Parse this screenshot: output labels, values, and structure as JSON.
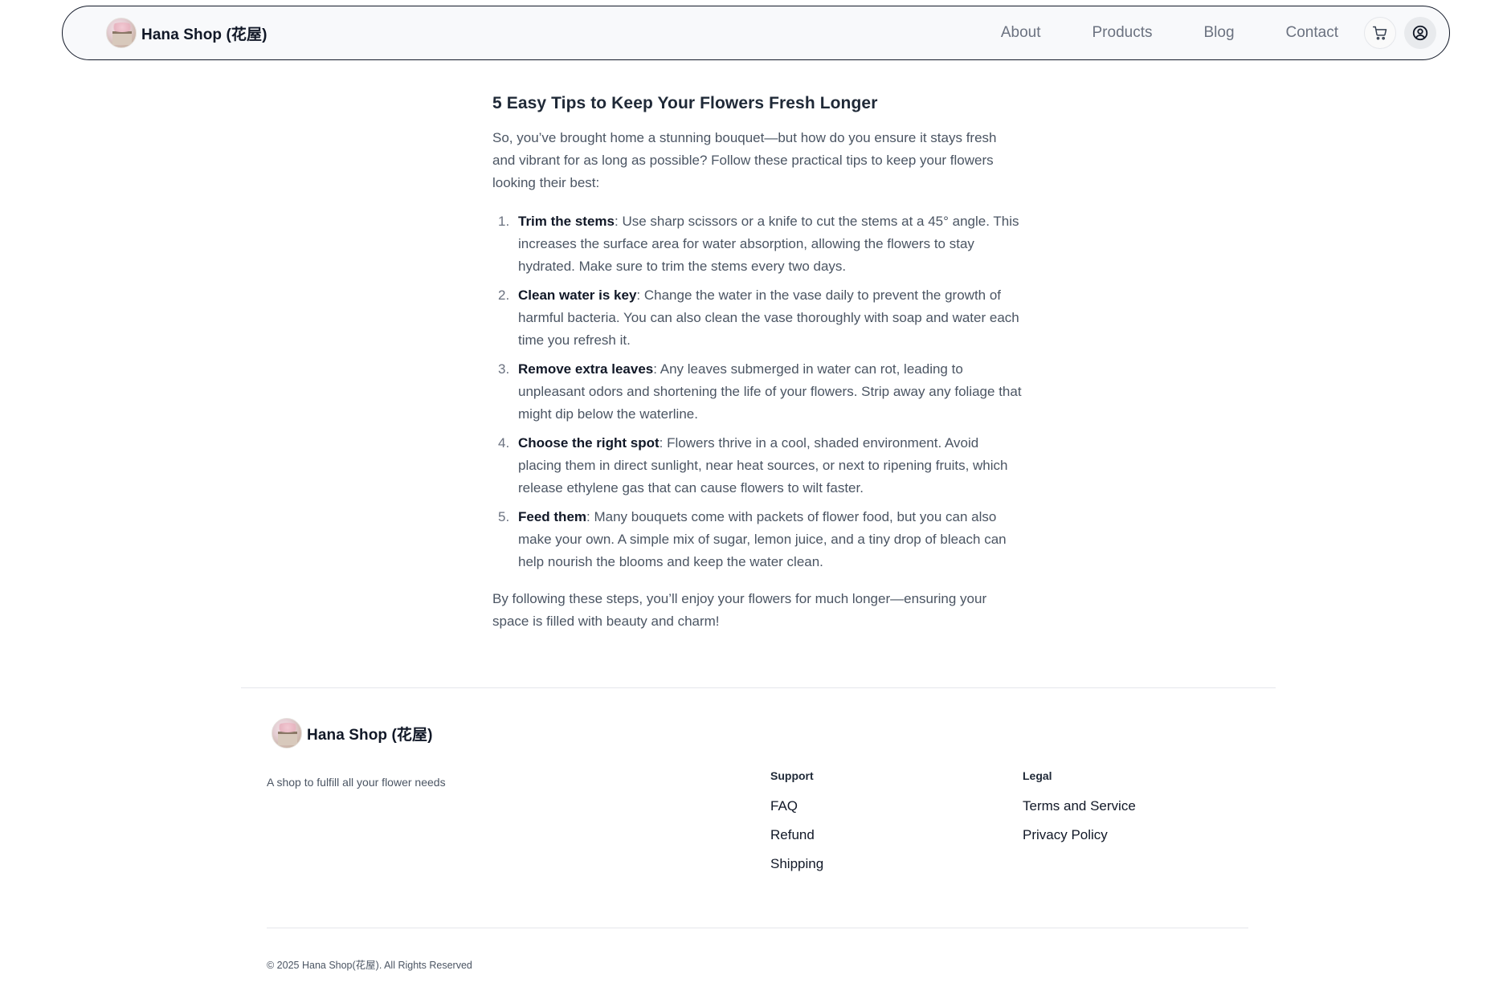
{
  "nav": {
    "brand": "Hana Shop (花屋)",
    "links": [
      "About",
      "Products",
      "Blog",
      "Contact"
    ],
    "cart_icon": "cart-icon",
    "user_icon": "user-circle-icon"
  },
  "article": {
    "title": "5 Easy Tips to Keep Your Flowers Fresh Longer",
    "intro": "So, you’ve brought home a stunning bouquet—but how do you ensure it stays fresh and vibrant for as long as possible? Follow these practical tips to keep your flowers looking their best:",
    "tips": [
      {
        "num": "1.",
        "title": "Trim the stems",
        "text": ": Use sharp scissors or a knife to cut the stems at a 45° angle. This increases the surface area for water absorption, allowing the flowers to stay hydrated. Make sure to trim the stems every two days."
      },
      {
        "num": "2.",
        "title": "Clean water is key",
        "text": ": Change the water in the vase daily to prevent the growth of harmful bacteria. You can also clean the vase thoroughly with soap and water each time you refresh it."
      },
      {
        "num": "3.",
        "title": "Remove extra leaves",
        "text": ": Any leaves submerged in water can rot, leading to unpleasant odors and shortening the life of your flowers. Strip away any foliage that might dip below the waterline."
      },
      {
        "num": "4.",
        "title": "Choose the right spot",
        "text": ": Flowers thrive in a cool, shaded environment. Avoid placing them in direct sunlight, near heat sources, or next to ripening fruits, which release ethylene gas that can cause flowers to wilt faster."
      },
      {
        "num": "5.",
        "title": "Feed them",
        "text": ": Many bouquets come with packets of flower food, but you can also make your own. A simple mix of sugar, lemon juice, and a tiny drop of bleach can help nourish the blooms and keep the water clean."
      }
    ],
    "outro": "By following these steps, you’ll enjoy your flowers for much longer—ensuring your space is filled with beauty and charm!"
  },
  "footer": {
    "brand": "Hana Shop (花屋)",
    "tagline": "A shop to fulfill all your flower needs",
    "support": {
      "heading": "Support",
      "links": [
        "FAQ",
        "Refund",
        "Shipping"
      ]
    },
    "legal": {
      "heading": "Legal",
      "links": [
        "Terms and Service",
        "Privacy Policy"
      ]
    },
    "copyright": "© 2025 Hana Shop(花屋). All Rights Reserved"
  }
}
